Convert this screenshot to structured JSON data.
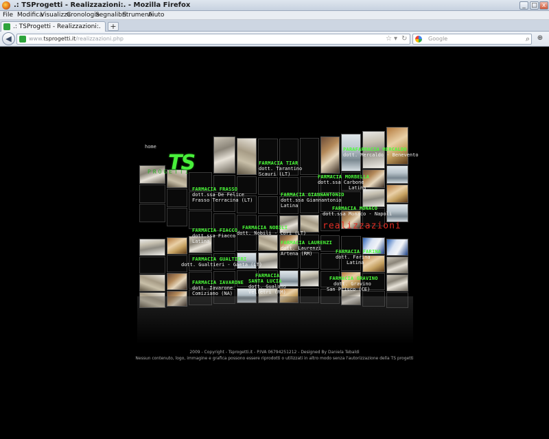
{
  "window": {
    "title": ".: TSProgetti - Realizzazioni:. - Mozilla Firefox",
    "min": "_",
    "max": "□",
    "close": "x"
  },
  "menu": [
    "File",
    "Modifica",
    "Visualizza",
    "Cronologia",
    "Segnalibri",
    "Strumenti",
    "Aiuto"
  ],
  "tab": {
    "label": ".: TSProgetti - Realizzazioni:.",
    "new": "+"
  },
  "nav": {
    "url_prefix": "www.",
    "url_domain": "tsprogetti.it",
    "url_path": "/realizzazioni.php",
    "search_placeholder": "Google"
  },
  "logo": {
    "home": "home",
    "ts": "TS",
    "progetti": "PROGETTI"
  },
  "heading": "realizzazioni",
  "pharmacies": [
    {
      "id": "tiar",
      "name": "FARMACIA TIAR",
      "lines": [
        "dott. Tarantino",
        "Scauri (LT)"
      ]
    },
    {
      "id": "mercaldo",
      "name": "PARAFARMACIA MERCALDO",
      "lines": [
        "dott. Mercaldo - Benevento"
      ]
    },
    {
      "id": "morbella",
      "name": "FARMACIA MORBELLA",
      "lines": [
        "dott.ssa Carbone",
        "Latina"
      ]
    },
    {
      "id": "frasso",
      "name": "FARMACIA FRASSO",
      "lines": [
        "dott.ssa De Felice",
        "Frasso Terracina (LT)"
      ]
    },
    {
      "id": "giannantonio",
      "name": "FARMACIA GIANNANTONIO",
      "lines": [
        "dott.ssa Giannantonio",
        "Latina"
      ]
    },
    {
      "id": "monaco",
      "name": "FARMACIA MONACO",
      "lines": [
        "dott.ssa Monaco - Napoli"
      ]
    },
    {
      "id": "fiacco",
      "name": "FARMACIA FIACCO",
      "lines": [
        "dott.ssa Fiacco",
        "Latina"
      ]
    },
    {
      "id": "nobili",
      "name": "FARMACIA NOBILI",
      "lines": [
        "dott. Nobili - Cori (LT)"
      ]
    },
    {
      "id": "laurenzi",
      "name": "FARMACIA LAURENZI",
      "lines": [
        "dott. Laurenzi",
        "Artena (RM)"
      ]
    },
    {
      "id": "farina",
      "name": "FARMACIA FARINA",
      "lines": [
        "dott. Farina",
        "Latina"
      ]
    },
    {
      "id": "gualtieri",
      "name": "FARMACIA GUALTIERI",
      "lines": [
        "dott. Gualtieri - Gaeta (LT)"
      ]
    },
    {
      "id": "gravino",
      "name": "FARMACIA GRAVINO",
      "lines": [
        "dott. Gravino",
        "San Prisco (CE)"
      ]
    },
    {
      "id": "iavarone",
      "name": "FARMACIA IAVARONE",
      "lines": [
        "dott. Iavarone",
        "Comiziano (NA)"
      ]
    },
    {
      "id": "santalucia",
      "name": "FARMACIA SANTA LUCIA",
      "lines": [
        "dott. Gualano",
        "Velletri (RM)"
      ]
    }
  ],
  "footer": {
    "line1": "2009 - Copyright - Tsprogetti.it - P.IVA 06794251212 - Designed By Daniela Tebaldi",
    "line2": "Nessun contenuto, logo, immagine e grafica possono essere riprodotti o utilizzati in altro modo senza l'autorizzazione della TS progetti"
  },
  "colors": {
    "label_green": "#4cff3a",
    "heading_red": "#e02d24",
    "background": "#000000"
  }
}
